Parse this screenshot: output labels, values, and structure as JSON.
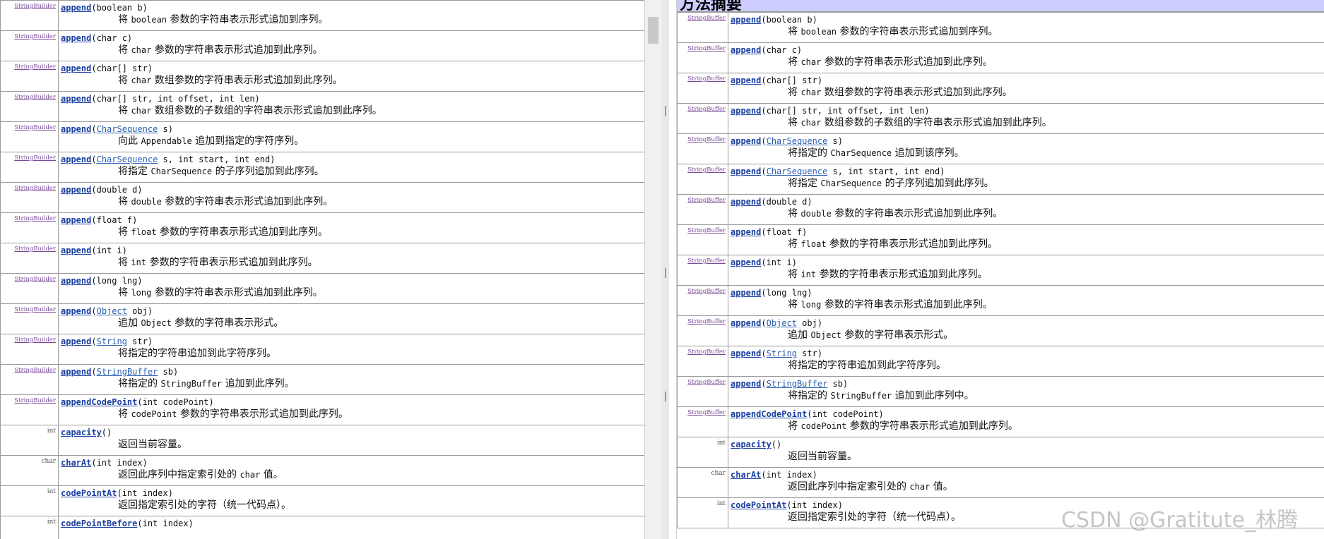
{
  "left": {
    "rows": [
      {
        "type": "StringBuilder",
        "method": "append",
        "params": [
          {
            "t": "(boolean b)"
          }
        ],
        "desc": [
          {
            "t": "将 "
          },
          {
            "c": "boolean"
          },
          {
            "t": " 参数的字符串表示形式追加到序列。"
          }
        ]
      },
      {
        "type": "StringBuilder",
        "method": "append",
        "params": [
          {
            "t": "(char c)"
          }
        ],
        "desc": [
          {
            "t": "将 "
          },
          {
            "c": "char"
          },
          {
            "t": " 参数的字符串表示形式追加到此序列。"
          }
        ]
      },
      {
        "type": "StringBuilder",
        "method": "append",
        "params": [
          {
            "t": "(char[] str)"
          }
        ],
        "desc": [
          {
            "t": "将 "
          },
          {
            "c": "char"
          },
          {
            "t": " 数组参数的字符串表示形式追加到此序列。"
          }
        ]
      },
      {
        "type": "StringBuilder",
        "method": "append",
        "params": [
          {
            "t": "(char[] str, int offset, int len)"
          }
        ],
        "desc": [
          {
            "t": "将 "
          },
          {
            "c": "char"
          },
          {
            "t": " 数组参数的子数组的字符串表示形式追加到此序列。"
          }
        ]
      },
      {
        "type": "StringBuilder",
        "method": "append",
        "params": [
          {
            "t": "("
          },
          {
            "l": "CharSequence"
          },
          {
            "t": " s)"
          }
        ],
        "desc": [
          {
            "t": "向此 "
          },
          {
            "c": "Appendable"
          },
          {
            "t": " 追加到指定的字符序列。"
          }
        ]
      },
      {
        "type": "StringBuilder",
        "method": "append",
        "params": [
          {
            "t": "("
          },
          {
            "l": "CharSequence"
          },
          {
            "t": " s, int start, int end)"
          }
        ],
        "desc": [
          {
            "t": "将指定 "
          },
          {
            "c": "CharSequence"
          },
          {
            "t": " 的子序列追加到此序列。"
          }
        ]
      },
      {
        "type": "StringBuilder",
        "method": "append",
        "params": [
          {
            "t": "(double d)"
          }
        ],
        "desc": [
          {
            "t": "将 "
          },
          {
            "c": "double"
          },
          {
            "t": " 参数的字符串表示形式追加到此序列。"
          }
        ]
      },
      {
        "type": "StringBuilder",
        "method": "append",
        "params": [
          {
            "t": "(float f)"
          }
        ],
        "desc": [
          {
            "t": "将 "
          },
          {
            "c": "float"
          },
          {
            "t": " 参数的字符串表示形式追加到此序列。"
          }
        ]
      },
      {
        "type": "StringBuilder",
        "method": "append",
        "params": [
          {
            "t": "(int i)"
          }
        ],
        "desc": [
          {
            "t": "将 "
          },
          {
            "c": "int"
          },
          {
            "t": " 参数的字符串表示形式追加到此序列。"
          }
        ]
      },
      {
        "type": "StringBuilder",
        "method": "append",
        "params": [
          {
            "t": "(long lng)"
          }
        ],
        "desc": [
          {
            "t": "将 "
          },
          {
            "c": "long"
          },
          {
            "t": " 参数的字符串表示形式追加到此序列。"
          }
        ]
      },
      {
        "type": "StringBuilder",
        "method": "append",
        "params": [
          {
            "t": "("
          },
          {
            "l": "Object"
          },
          {
            "t": " obj)"
          }
        ],
        "desc": [
          {
            "t": "追加 "
          },
          {
            "c": "Object"
          },
          {
            "t": " 参数的字符串表示形式。"
          }
        ]
      },
      {
        "type": "StringBuilder",
        "method": "append",
        "params": [
          {
            "t": "("
          },
          {
            "l": "String"
          },
          {
            "t": " str)"
          }
        ],
        "desc": [
          {
            "t": "将指定的字符串追加到此字符序列。"
          }
        ]
      },
      {
        "type": "StringBuilder",
        "method": "append",
        "params": [
          {
            "t": "("
          },
          {
            "l": "StringBuffer"
          },
          {
            "t": " sb)"
          }
        ],
        "desc": [
          {
            "t": "将指定的 "
          },
          {
            "c": "StringBuffer"
          },
          {
            "t": " 追加到此序列。"
          }
        ]
      },
      {
        "type": "StringBuilder",
        "method": "appendCodePoint",
        "params": [
          {
            "t": "(int codePoint)"
          }
        ],
        "desc": [
          {
            "t": "将 "
          },
          {
            "c": "codePoint"
          },
          {
            "t": " 参数的字符串表示形式追加到此序列。"
          }
        ]
      },
      {
        "type": "int",
        "method": "capacity",
        "params": [
          {
            "t": "()"
          }
        ],
        "desc": [
          {
            "t": "返回当前容量。"
          }
        ]
      },
      {
        "type": "char",
        "method": "charAt",
        "params": [
          {
            "t": "(int index)"
          }
        ],
        "desc": [
          {
            "t": "返回此序列中指定索引处的 "
          },
          {
            "c": "char"
          },
          {
            "t": " 值。"
          }
        ]
      },
      {
        "type": "int",
        "method": "codePointAt",
        "params": [
          {
            "t": "(int index)"
          }
        ],
        "desc": [
          {
            "t": "返回指定索引处的字符（统一代码点）。"
          }
        ]
      },
      {
        "type": "int",
        "method": "codePointBefore",
        "params": [
          {
            "t": "(int index)"
          }
        ],
        "desc": []
      }
    ]
  },
  "right": {
    "title": "方法摘要",
    "rows": [
      {
        "type": "StringBuffer",
        "method": "append",
        "params": [
          {
            "t": "(boolean b)"
          }
        ],
        "desc": [
          {
            "t": "将 "
          },
          {
            "c": "boolean"
          },
          {
            "t": " 参数的字符串表示形式追加到序列。"
          }
        ]
      },
      {
        "type": "StringBuffer",
        "method": "append",
        "params": [
          {
            "t": "(char c)"
          }
        ],
        "desc": [
          {
            "t": "将 "
          },
          {
            "c": "char"
          },
          {
            "t": " 参数的字符串表示形式追加到此序列。"
          }
        ]
      },
      {
        "type": "StringBuffer",
        "method": "append",
        "params": [
          {
            "t": "(char[] str)"
          }
        ],
        "desc": [
          {
            "t": "将 "
          },
          {
            "c": "char"
          },
          {
            "t": " 数组参数的字符串表示形式追加到此序列。"
          }
        ]
      },
      {
        "type": "StringBuffer",
        "method": "append",
        "params": [
          {
            "t": "(char[] str, int offset, int len)"
          }
        ],
        "desc": [
          {
            "t": "将 "
          },
          {
            "c": "char"
          },
          {
            "t": " 数组参数的子数组的字符串表示形式追加到此序列。"
          }
        ]
      },
      {
        "type": "StringBuffer",
        "method": "append",
        "params": [
          {
            "t": "("
          },
          {
            "l": "CharSequence"
          },
          {
            "t": " s)"
          }
        ],
        "desc": [
          {
            "t": "将指定的 "
          },
          {
            "c": "CharSequence"
          },
          {
            "t": " 追加到该序列。"
          }
        ]
      },
      {
        "type": "StringBuffer",
        "method": "append",
        "params": [
          {
            "t": "("
          },
          {
            "l": "CharSequence"
          },
          {
            "t": " s, int start, int end)"
          }
        ],
        "desc": [
          {
            "t": "将指定 "
          },
          {
            "c": "CharSequence"
          },
          {
            "t": " 的子序列追加到此序列。"
          }
        ]
      },
      {
        "type": "StringBuffer",
        "method": "append",
        "params": [
          {
            "t": "(double d)"
          }
        ],
        "desc": [
          {
            "t": "将 "
          },
          {
            "c": "double"
          },
          {
            "t": " 参数的字符串表示形式追加到此序列。"
          }
        ]
      },
      {
        "type": "StringBuffer",
        "method": "append",
        "params": [
          {
            "t": "(float f)"
          }
        ],
        "desc": [
          {
            "t": "将 "
          },
          {
            "c": "float"
          },
          {
            "t": " 参数的字符串表示形式追加到此序列。"
          }
        ]
      },
      {
        "type": "StringBuffer",
        "method": "append",
        "params": [
          {
            "t": "(int i)"
          }
        ],
        "desc": [
          {
            "t": "将 "
          },
          {
            "c": "int"
          },
          {
            "t": " 参数的字符串表示形式追加到此序列。"
          }
        ]
      },
      {
        "type": "StringBuffer",
        "method": "append",
        "params": [
          {
            "t": "(long lng)"
          }
        ],
        "desc": [
          {
            "t": "将 "
          },
          {
            "c": "long"
          },
          {
            "t": " 参数的字符串表示形式追加到此序列。"
          }
        ]
      },
      {
        "type": "StringBuffer",
        "method": "append",
        "params": [
          {
            "t": "("
          },
          {
            "l": "Object"
          },
          {
            "t": " obj)"
          }
        ],
        "desc": [
          {
            "t": "追加 "
          },
          {
            "c": "Object"
          },
          {
            "t": " 参数的字符串表示形式。"
          }
        ]
      },
      {
        "type": "StringBuffer",
        "method": "append",
        "params": [
          {
            "t": "("
          },
          {
            "l": "String"
          },
          {
            "t": " str)"
          }
        ],
        "desc": [
          {
            "t": "将指定的字符串追加到此字符序列。"
          }
        ]
      },
      {
        "type": "StringBuffer",
        "method": "append",
        "params": [
          {
            "t": "("
          },
          {
            "l": "StringBuffer"
          },
          {
            "t": " sb)"
          }
        ],
        "desc": [
          {
            "t": "将指定的 "
          },
          {
            "c": "StringBuffer"
          },
          {
            "t": " 追加到此序列中。"
          }
        ]
      },
      {
        "type": "StringBuffer",
        "method": "appendCodePoint",
        "params": [
          {
            "t": "(int codePoint)"
          }
        ],
        "desc": [
          {
            "t": "将 "
          },
          {
            "c": "codePoint"
          },
          {
            "t": " 参数的字符串表示形式追加到此序列。"
          }
        ]
      },
      {
        "type": "int",
        "method": "capacity",
        "params": [
          {
            "t": "()"
          }
        ],
        "desc": [
          {
            "t": "返回当前容量。"
          }
        ]
      },
      {
        "type": "char",
        "method": "charAt",
        "params": [
          {
            "t": "(int index)"
          }
        ],
        "desc": [
          {
            "t": "返回此序列中指定索引处的 "
          },
          {
            "c": "char"
          },
          {
            "t": " 值。"
          }
        ]
      },
      {
        "type": "int",
        "method": "codePointAt",
        "params": [
          {
            "t": "(int index)"
          }
        ],
        "desc": [
          {
            "t": "返回指定索引处的字符（统一代码点）。"
          }
        ]
      }
    ]
  },
  "watermark": "CSDN @Gratitute_林腾",
  "colors": {
    "header_bg": "#ccccff",
    "method_link": "#1a3fa0",
    "type_link": "#7a4c9a",
    "border": "#9a9a9a"
  }
}
